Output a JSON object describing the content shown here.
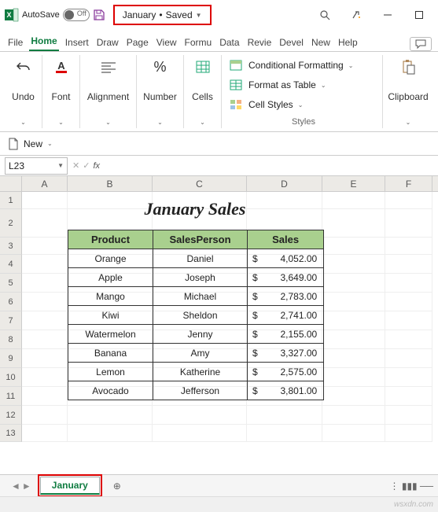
{
  "titlebar": {
    "autosave_label": "AutoSave",
    "autosave_off": "Off",
    "doc_name": "January",
    "save_state": "Saved"
  },
  "tabs": {
    "file": "File",
    "home": "Home",
    "insert": "Insert",
    "draw": "Draw",
    "page": "Page",
    "view": "View",
    "formu": "Formu",
    "data": "Data",
    "revie": "Revie",
    "devel": "Devel",
    "new": "New",
    "help": "Help"
  },
  "ribbon": {
    "undo": "Undo",
    "font": "Font",
    "alignment": "Alignment",
    "number": "Number",
    "cells": "Cells",
    "cond_fmt": "Conditional Formatting",
    "fmt_table": "Format as Table",
    "cell_styles": "Cell Styles",
    "styles_label": "Styles",
    "clipboard": "Clipboard"
  },
  "qat": {
    "new": "New"
  },
  "namebox": "L23",
  "columns": [
    "A",
    "B",
    "C",
    "D",
    "E",
    "F"
  ],
  "row_nums": [
    "1",
    "2",
    "3",
    "4",
    "5",
    "6",
    "7",
    "8",
    "9",
    "10",
    "11",
    "12",
    "13"
  ],
  "sheet": {
    "title": "January Sales",
    "headers": [
      "Product",
      "SalesPerson",
      "Sales"
    ],
    "rows": [
      {
        "product": "Orange",
        "person": "Daniel",
        "dollar": "$",
        "amount": "4,052.00"
      },
      {
        "product": "Apple",
        "person": "Joseph",
        "dollar": "$",
        "amount": "3,649.00"
      },
      {
        "product": "Mango",
        "person": "Michael",
        "dollar": "$",
        "amount": "2,783.00"
      },
      {
        "product": "Kiwi",
        "person": "Sheldon",
        "dollar": "$",
        "amount": "2,741.00"
      },
      {
        "product": "Watermelon",
        "person": "Jenny",
        "dollar": "$",
        "amount": "2,155.00"
      },
      {
        "product": "Banana",
        "person": "Amy",
        "dollar": "$",
        "amount": "3,327.00"
      },
      {
        "product": "Lemon",
        "person": "Katherine",
        "dollar": "$",
        "amount": "2,575.00"
      },
      {
        "product": "Avocado",
        "person": "Jefferson",
        "dollar": "$",
        "amount": "3,801.00"
      }
    ]
  },
  "sheet_tab": "January",
  "watermark": "wsxdn.com"
}
